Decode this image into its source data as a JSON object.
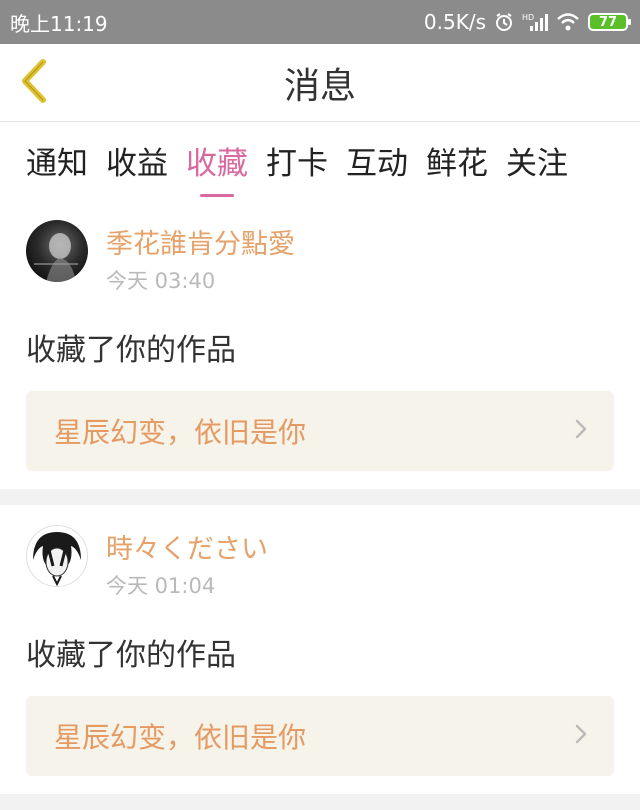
{
  "status_bar": {
    "time": "晚上11:19",
    "net_speed": "0.5K/s",
    "battery": "77",
    "icons": [
      "alarm-icon",
      "hd-signal-icon",
      "wifi-icon",
      "battery-icon"
    ]
  },
  "header": {
    "title": "消息",
    "back_icon": "chevron-left-icon"
  },
  "tabs": [
    {
      "label": "通知",
      "active": false
    },
    {
      "label": "收益",
      "active": false
    },
    {
      "label": "收藏",
      "active": true
    },
    {
      "label": "打卡",
      "active": false
    },
    {
      "label": "互动",
      "active": false
    },
    {
      "label": "鲜花",
      "active": false
    },
    {
      "label": "关注",
      "active": false
    }
  ],
  "messages": [
    {
      "user": "季花誰肯分點愛",
      "time": "今天 03:40",
      "action": "收藏了你的作品",
      "work_title": "星辰幻变，依旧是你"
    },
    {
      "user": "時々ください",
      "time": "今天 01:04",
      "action": "收藏了你的作品",
      "work_title": "星辰幻变，依旧是你"
    }
  ],
  "colors": {
    "accent_pink": "#d96aa0",
    "name_orange": "#e5a26a",
    "link_bg": "#f5f3ea",
    "status_bar": "#8b8b8b",
    "back_icon": "#e0c22e",
    "battery_green": "#5bbf2a"
  }
}
